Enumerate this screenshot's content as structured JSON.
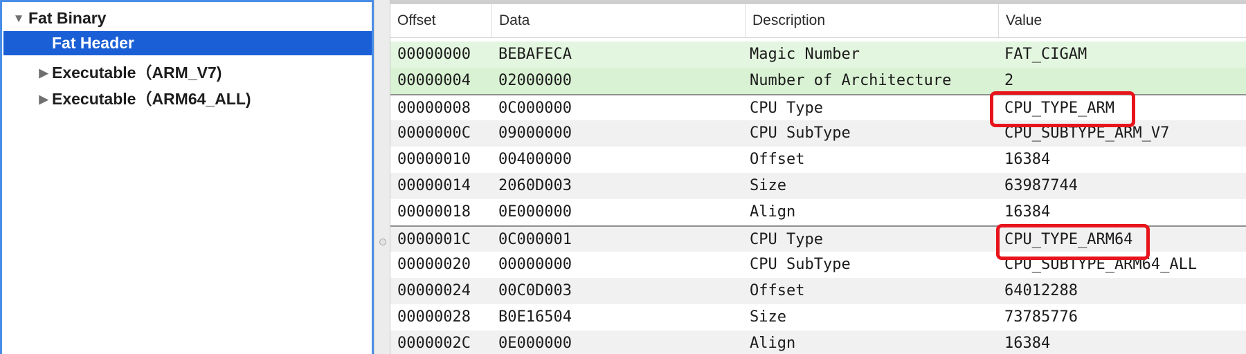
{
  "sidebar": {
    "items": [
      {
        "label": "Fat Binary",
        "expanded": true,
        "selected": false
      },
      {
        "label": "Fat Header",
        "selected": true
      },
      {
        "label": "Executable（ARM_V7)",
        "expanded": false,
        "selected": false
      },
      {
        "label": "Executable（ARM64_ALL)",
        "expanded": false,
        "selected": false
      }
    ]
  },
  "table": {
    "columns": [
      "Offset",
      "Data",
      "Description",
      "Value"
    ],
    "rows": [
      {
        "offset": "00000000",
        "data": "BEBAFECA",
        "description": "Magic Number",
        "value": "FAT_CIGAM"
      },
      {
        "offset": "00000004",
        "data": "02000000",
        "description": "Number of Architecture",
        "value": "2"
      },
      {
        "offset": "00000008",
        "data": "0C000000",
        "description": "CPU Type",
        "value": "CPU_TYPE_ARM"
      },
      {
        "offset": "0000000C",
        "data": "09000000",
        "description": "CPU SubType",
        "value": "CPU_SUBTYPE_ARM_V7"
      },
      {
        "offset": "00000010",
        "data": "00400000",
        "description": "Offset",
        "value": "16384"
      },
      {
        "offset": "00000014",
        "data": "2060D003",
        "description": "Size",
        "value": "63987744"
      },
      {
        "offset": "00000018",
        "data": "0E000000",
        "description": "Align",
        "value": "16384"
      },
      {
        "offset": "0000001C",
        "data": "0C000001",
        "description": "CPU Type",
        "value": "CPU_TYPE_ARM64"
      },
      {
        "offset": "00000020",
        "data": "00000000",
        "description": "CPU SubType",
        "value": "CPU_SUBTYPE_ARM64_ALL"
      },
      {
        "offset": "00000024",
        "data": "00C0D003",
        "description": "Offset",
        "value": "64012288"
      },
      {
        "offset": "00000028",
        "data": "B0E16504",
        "description": "Size",
        "value": "73785776"
      },
      {
        "offset": "0000002C",
        "data": "0E000000",
        "description": "Align",
        "value": "16384"
      }
    ]
  },
  "colors": {
    "selection": "#1b5fd6",
    "header_row_green": "#e3f6df",
    "highlight": "#e8141b",
    "focus_border": "#4a8de6"
  },
  "icons": {
    "expanded": "disclosure-triangle-down",
    "collapsed": "disclosure-triangle-right"
  }
}
